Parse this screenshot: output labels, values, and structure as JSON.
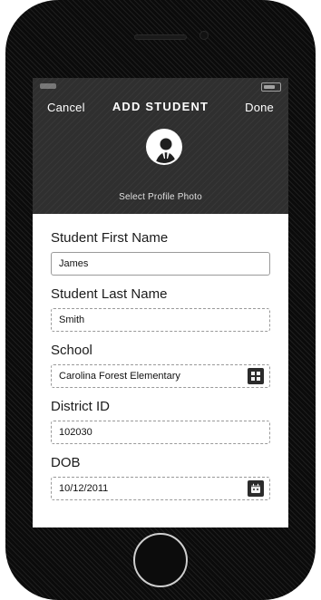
{
  "nav": {
    "cancel": "Cancel",
    "title": "ADD STUDENT",
    "done": "Done"
  },
  "header": {
    "avatar_hint": "Select Profile Photo"
  },
  "form": {
    "first_name_label": "Student First Name",
    "first_name_value": "James",
    "last_name_label": "Student Last Name",
    "last_name_value": "Smith",
    "school_label": "School",
    "school_value": "Carolina Forest Elementary",
    "district_id_label": "District ID",
    "district_id_value": "102030",
    "dob_label": "DOB",
    "dob_value": "10/12/2011"
  },
  "icons": {
    "school_picker": "grid-icon",
    "dob_picker": "calendar-icon",
    "avatar": "student-icon"
  },
  "colors": {
    "header_bg": "#2f2f2f",
    "text": "#111111",
    "border": "#9a9a9a",
    "accent": "#2b2b2b"
  }
}
